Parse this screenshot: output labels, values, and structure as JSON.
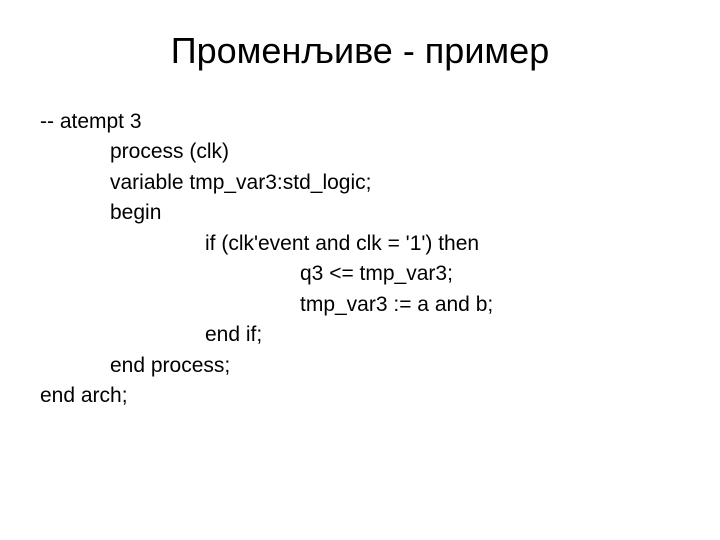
{
  "title": "Променљиве - пример",
  "code": {
    "line1": "-- atempt 3",
    "line2": "process (clk)",
    "line3": "variable tmp_var3:std_logic;",
    "line4": "begin",
    "line5": "if (clk'event and clk = '1') then",
    "line6": "q3 <= tmp_var3;",
    "line7": "tmp_var3 := a and b;",
    "line8": "end if;",
    "line9": "end process;",
    "line10": "end arch;"
  }
}
